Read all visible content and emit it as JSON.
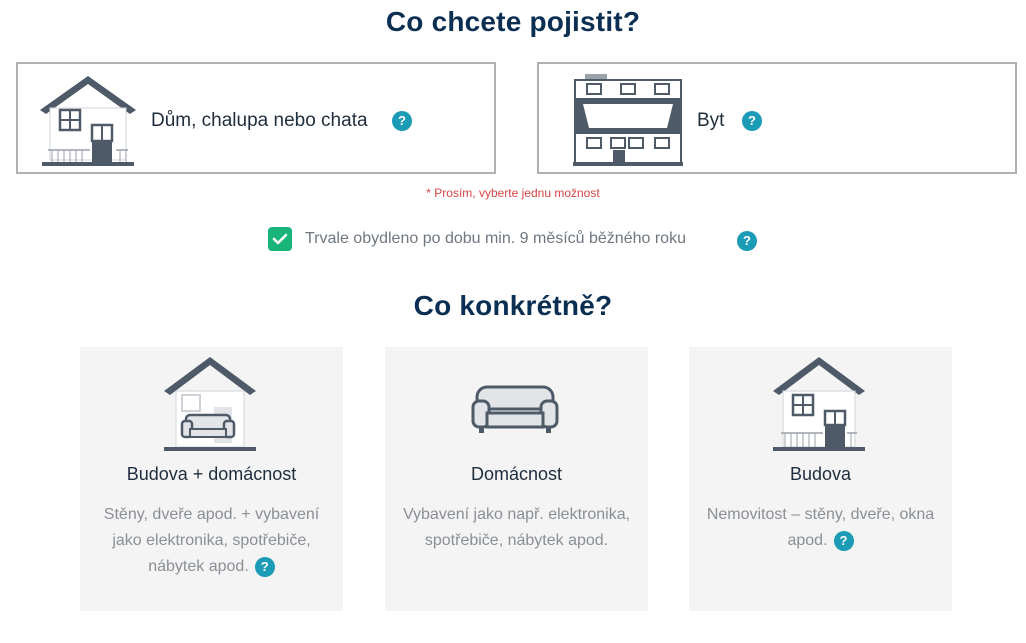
{
  "section1": {
    "title": "Co chcete pojistit?"
  },
  "options": [
    {
      "label": "Dům, chalupa nebo chata",
      "help": "?"
    },
    {
      "label": "Byt",
      "help": "?"
    }
  ],
  "validation": {
    "message": "* Prosím, vyberte jednu možnost"
  },
  "checkbox": {
    "label": "Trvale obydleno po dobu min. 9 měsíců běžného roku",
    "checked": true,
    "help": "?"
  },
  "section2": {
    "title": "Co konkrétně?"
  },
  "cards": [
    {
      "title": "Budova + domácnost",
      "desc": "Stěny, dveře apod. + vybavení jako elektronika, spotřebiče, nábytek apod.",
      "help": "?"
    },
    {
      "title": "Domácnost",
      "desc": "Vybavení jako např. elektronika, spotřebiče, nábytek apod."
    },
    {
      "title": "Budova",
      "desc": "Nemovitost – stěny, dveře, okna apod.",
      "help": "?"
    }
  ],
  "colors": {
    "primary_text": "#0b2f52",
    "help_icon": "#1b9bb5",
    "checkbox": "#19b47a",
    "error": "#d64545",
    "icon_slate": "#4f5a69"
  }
}
